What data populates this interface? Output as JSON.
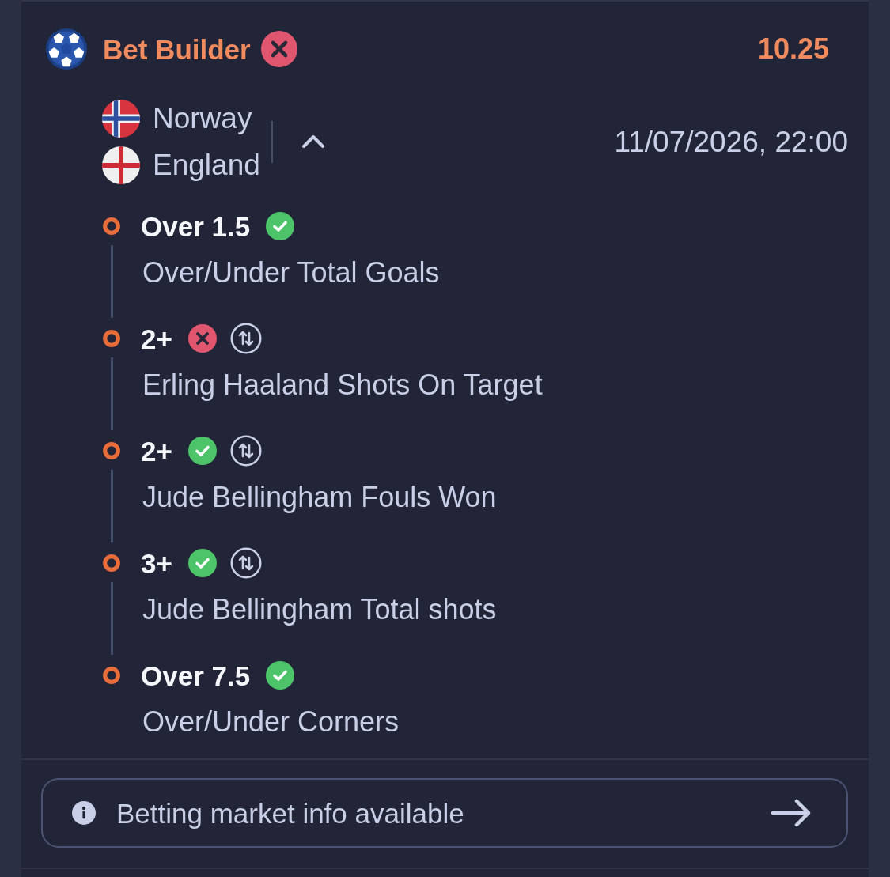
{
  "header": {
    "title": "Bet Builder",
    "won": false,
    "odds": "10.25"
  },
  "match": {
    "teams": [
      {
        "name": "Norway"
      },
      {
        "name": "England"
      }
    ],
    "expanded": true,
    "datetime": "11/07/2026, 22:00"
  },
  "selections": [
    {
      "pick": "Over 1.5",
      "won": true,
      "swap": false,
      "market": "Over/Under Total Goals"
    },
    {
      "pick": "2+",
      "won": false,
      "swap": true,
      "market": "Erling Haaland Shots On Target"
    },
    {
      "pick": "2+",
      "won": true,
      "swap": true,
      "market": "Jude Bellingham Fouls Won"
    },
    {
      "pick": "3+",
      "won": true,
      "swap": true,
      "market": "Jude Bellingham Total shots"
    },
    {
      "pick": "Over 7.5",
      "won": true,
      "swap": false,
      "market": "Over/Under Corners"
    }
  ],
  "info_bar": {
    "text": "Betting market info available"
  }
}
